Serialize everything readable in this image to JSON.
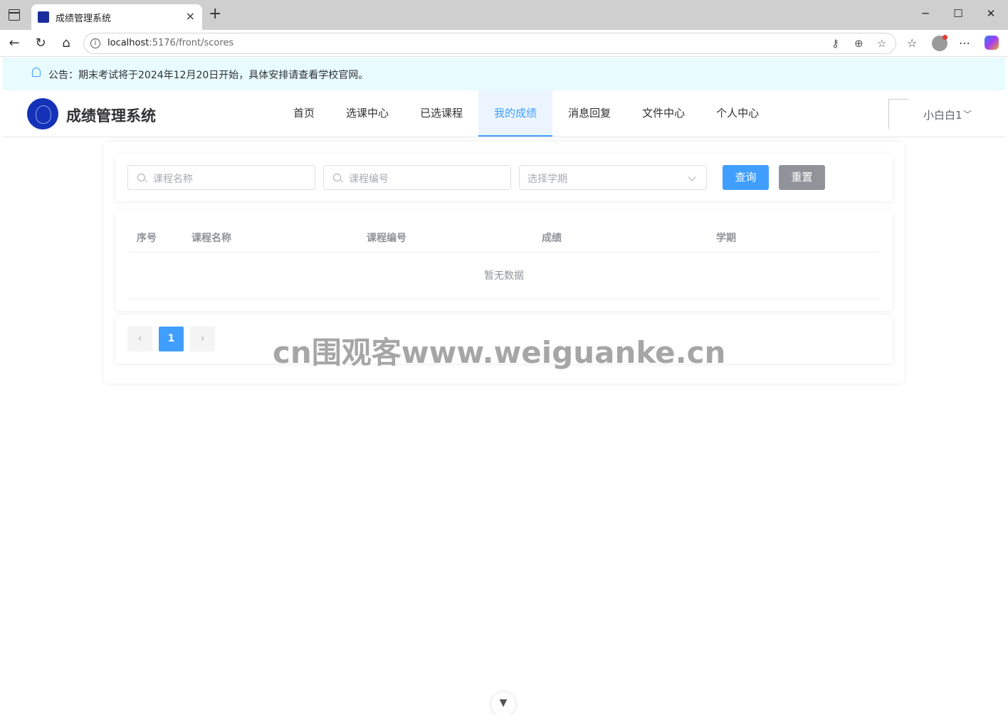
{
  "browser": {
    "tab_title": "成绩管理系统",
    "url_host": "localhost",
    "url_path": ":5176/front/scores",
    "tab_close": "×",
    "new_tab": "+",
    "minimize": "─",
    "maximize": "☐",
    "close": "✕"
  },
  "notice": {
    "text": "公告：期末考试将于2024年12月20日开始，具体安排请查看学校官网。"
  },
  "header": {
    "site_title": "成绩管理系统",
    "nav": [
      "首页",
      "选课中心",
      "已选课程",
      "我的成绩",
      "消息回复",
      "文件中心",
      "个人中心"
    ],
    "active_nav": "我的成绩",
    "user_name": "小白白1"
  },
  "search": {
    "course_name_placeholder": "课程名称",
    "course_code_placeholder": "课程编号",
    "semester_placeholder": "选择学期",
    "query_label": "查询",
    "reset_label": "重置"
  },
  "table": {
    "columns": [
      "序号",
      "课程名称",
      "课程编号",
      "成绩",
      "学期"
    ],
    "empty_text": "暂无数据"
  },
  "pagination": {
    "prev": "‹",
    "current_page": "1",
    "next": "›"
  },
  "watermark": "cn围观客www.weiguanke.cn",
  "colors": {
    "primary": "#409eff",
    "info": "#909399",
    "notice_bg": "#e8fbff"
  }
}
